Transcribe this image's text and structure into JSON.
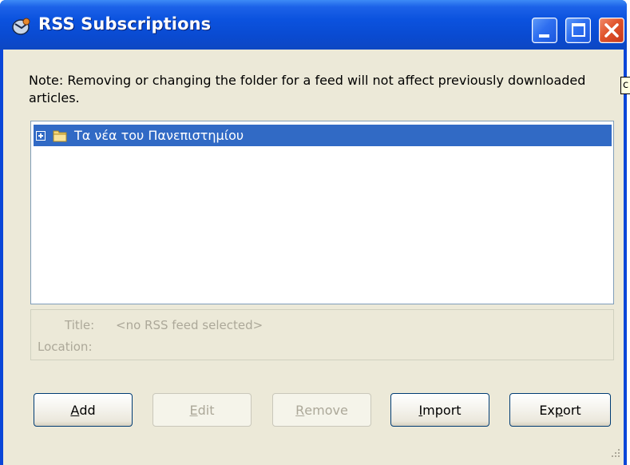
{
  "window": {
    "title": "RSS Subscriptions",
    "app_icon": "mail-client-icon",
    "controls": [
      "minimize-icon",
      "maximize-icon",
      "close-icon"
    ]
  },
  "tooltip_fragment": "c",
  "note": "Note: Removing or changing the folder for a feed will not affect previously downloaded articles.",
  "tree": {
    "items": [
      {
        "label": "Τα νέα του Πανεπιστημίου",
        "selected": true,
        "expandable": true,
        "icon": "folder-icon"
      }
    ]
  },
  "details": {
    "title_label": "Title:",
    "title_value": "<no RSS feed selected>",
    "location_label": "Location:",
    "location_value": ""
  },
  "buttons": {
    "add": {
      "mnemonic": "A",
      "rest": "dd",
      "enabled": true
    },
    "edit": {
      "mnemonic": "E",
      "rest": "dit",
      "enabled": false
    },
    "remove": {
      "mnemonic": "R",
      "rest": "emove",
      "enabled": false
    },
    "import": {
      "mnemonic": "I",
      "rest": "mport",
      "enabled": true
    },
    "export_pre": "Ex",
    "export_mnemonic": "p",
    "export_post": "ort"
  },
  "colors": {
    "titlebar": "#0a4ad0",
    "selection": "#316ac5",
    "dialog_bg": "#ece9d8",
    "disabled_text": "#aca899"
  }
}
